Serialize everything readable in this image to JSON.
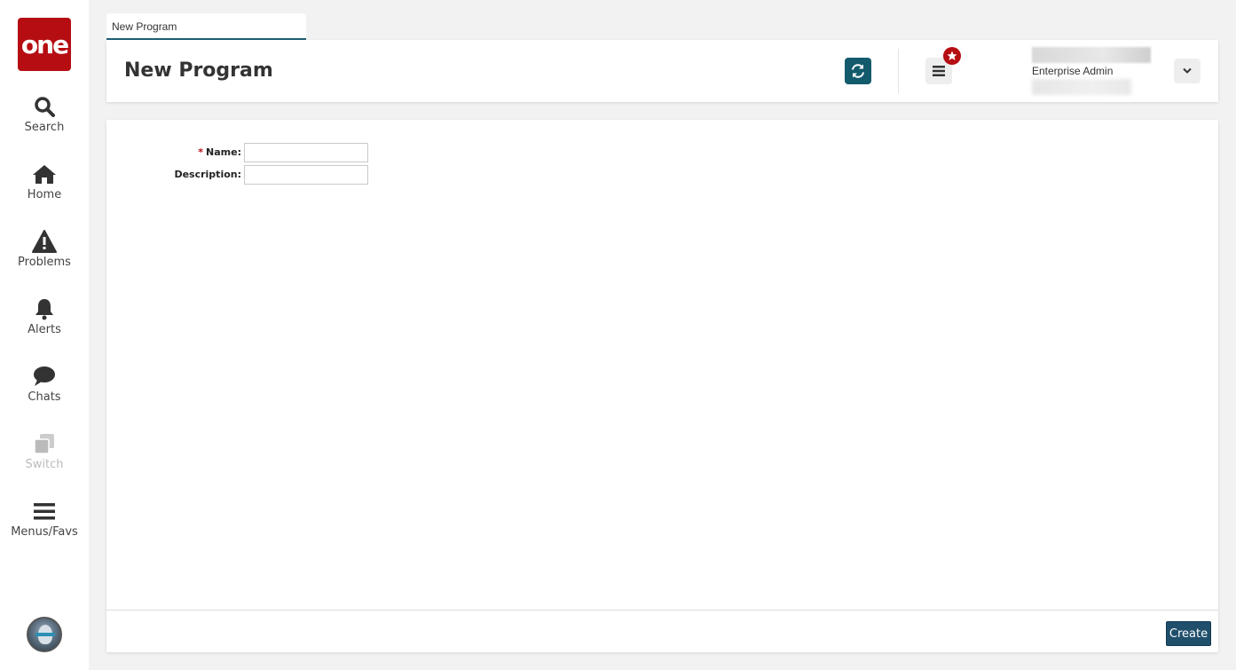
{
  "logo": {
    "text": "one"
  },
  "sidebar": {
    "items": [
      {
        "id": "search",
        "label": "Search",
        "icon": "search-icon"
      },
      {
        "id": "home",
        "label": "Home",
        "icon": "home-icon"
      },
      {
        "id": "problems",
        "label": "Problems",
        "icon": "warning-icon"
      },
      {
        "id": "alerts",
        "label": "Alerts",
        "icon": "bell-icon"
      },
      {
        "id": "chats",
        "label": "Chats",
        "icon": "chat-icon"
      },
      {
        "id": "switch",
        "label": "Switch",
        "icon": "switch-icon",
        "disabled": true
      },
      {
        "id": "menus",
        "label": "Menus/Favs",
        "icon": "hamburger-icon"
      }
    ]
  },
  "tab": {
    "label": "New Program"
  },
  "header": {
    "title": "New Program",
    "user_role": "Enterprise Admin"
  },
  "form": {
    "name_label": "Name:",
    "name_required_mark": "*",
    "name_value": "",
    "description_label": "Description:",
    "description_value": ""
  },
  "footer": {
    "create_label": "Create"
  },
  "colors": {
    "brand": "#b50d12",
    "accent": "#135a6c",
    "button": "#1f4f6b"
  }
}
